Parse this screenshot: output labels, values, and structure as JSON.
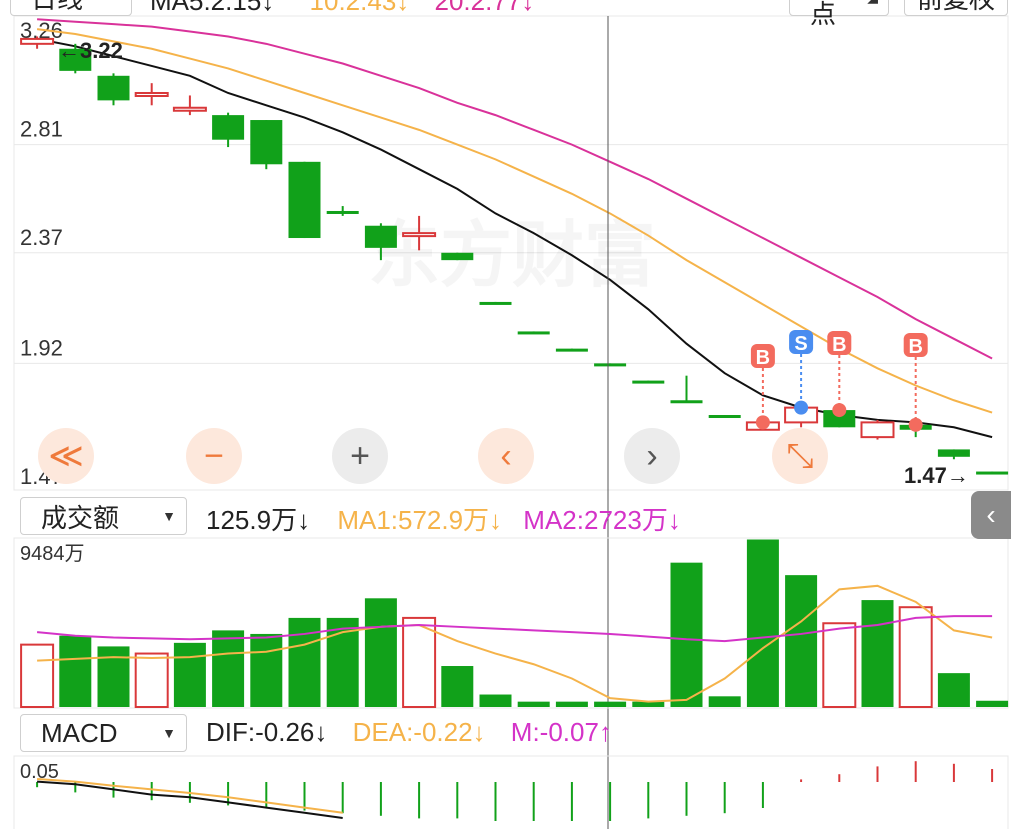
{
  "header": {
    "period_label": "日线",
    "ma_labels": [
      {
        "text": "MA5:2.15↓",
        "color": "#222222"
      },
      {
        "text": "10:2.43↓",
        "color": "#f5b34a"
      },
      {
        "text": "20:2.77↓",
        "color": "#d9329a"
      }
    ],
    "mode_label": "BK点",
    "adjust_label": "前复权"
  },
  "colors": {
    "up": "#d9383a",
    "down": "#11a11a",
    "ma5": "#111111",
    "ma10": "#f5b34a",
    "ma20": "#d9329a",
    "grid": "#e8e8e8",
    "signal_red": "#f36b5e",
    "signal_blue": "#4a8df0"
  },
  "price_panel": {
    "y_ticks": [
      "3.26",
      "2.81",
      "2.37",
      "1.92",
      "1.47"
    ],
    "high_marker": "3.22",
    "low_marker": "1.47",
    "watermark": "东方财富"
  },
  "controls": [
    {
      "name": "scroll-fast-left-button",
      "symbol": "≪",
      "style": "or"
    },
    {
      "name": "zoom-out-button",
      "symbol": "−",
      "style": "or"
    },
    {
      "name": "zoom-in-button",
      "symbol": "+",
      "style": "gr"
    },
    {
      "name": "scroll-left-button",
      "symbol": "‹",
      "style": "or"
    },
    {
      "name": "scroll-right-button",
      "symbol": "›",
      "style": "gr"
    },
    {
      "name": "expand-button",
      "symbol": "⤡",
      "style": "or"
    }
  ],
  "volume_panel": {
    "indicator": "成交额",
    "legend": [
      {
        "text": "125.9万↓",
        "color": "#222222"
      },
      {
        "text": "MA1:572.9万↓",
        "color": "#f5b34a"
      },
      {
        "text": "MA2:2723万↓",
        "color": "#d433c8"
      }
    ],
    "max_label": "9484万",
    "side_button": "‹"
  },
  "macd_panel": {
    "indicator": "MACD",
    "legend": [
      {
        "text": "DIF:-0.26↓",
        "color": "#222222"
      },
      {
        "text": "DEA:-0.22↓",
        "color": "#f5b34a"
      },
      {
        "text": "M:-0.07↑",
        "color": "#d433c8"
      }
    ],
    "top_label": "0.05"
  },
  "chart_data": [
    {
      "type": "candlestick",
      "title": "",
      "ylim": [
        1.47,
        3.26
      ],
      "candles": [
        {
          "o": 3.22,
          "c": 3.24,
          "h": 3.25,
          "l": 3.2,
          "dir": "up"
        },
        {
          "o": 3.2,
          "c": 3.11,
          "h": 3.22,
          "l": 3.1,
          "dir": "down"
        },
        {
          "o": 3.09,
          "c": 2.99,
          "h": 3.1,
          "l": 2.97,
          "dir": "down"
        },
        {
          "o": 3.01,
          "c": 3.02,
          "h": 3.06,
          "l": 2.97,
          "dir": "up"
        },
        {
          "o": 2.95,
          "c": 2.96,
          "h": 3.01,
          "l": 2.93,
          "dir": "up"
        },
        {
          "o": 2.93,
          "c": 2.83,
          "h": 2.94,
          "l": 2.8,
          "dir": "down"
        },
        {
          "o": 2.91,
          "c": 2.73,
          "h": 2.91,
          "l": 2.71,
          "dir": "down"
        },
        {
          "o": 2.74,
          "c": 2.43,
          "h": 2.74,
          "l": 2.43,
          "dir": "down"
        },
        {
          "o": 2.54,
          "c": 2.53,
          "h": 2.56,
          "l": 2.52,
          "dir": "down"
        },
        {
          "o": 2.48,
          "c": 2.39,
          "h": 2.49,
          "l": 2.34,
          "dir": "down"
        },
        {
          "o": 2.44,
          "c": 2.45,
          "h": 2.52,
          "l": 2.38,
          "dir": "up"
        },
        {
          "o": 2.37,
          "c": 2.34,
          "h": 2.37,
          "l": 2.34,
          "dir": "down"
        },
        {
          "o": 2.17,
          "c": 2.16,
          "h": 2.17,
          "l": 2.16,
          "dir": "down"
        },
        {
          "o": 2.05,
          "c": 2.04,
          "h": 2.05,
          "l": 2.04,
          "dir": "down"
        },
        {
          "o": 1.98,
          "c": 1.97,
          "h": 1.98,
          "l": 1.97,
          "dir": "down"
        },
        {
          "o": 1.92,
          "c": 1.91,
          "h": 1.92,
          "l": 1.91,
          "dir": "down"
        },
        {
          "o": 1.85,
          "c": 1.84,
          "h": 1.85,
          "l": 1.84,
          "dir": "down"
        },
        {
          "o": 1.77,
          "c": 1.76,
          "h": 1.87,
          "l": 1.76,
          "dir": "down"
        },
        {
          "o": 1.71,
          "c": 1.7,
          "h": 1.71,
          "l": 1.7,
          "dir": "down"
        },
        {
          "o": 1.65,
          "c": 1.68,
          "h": 1.7,
          "l": 1.66,
          "dir": "up"
        },
        {
          "o": 1.68,
          "c": 1.74,
          "h": 1.75,
          "l": 1.66,
          "dir": "up"
        },
        {
          "o": 1.73,
          "c": 1.66,
          "h": 1.73,
          "l": 1.66,
          "dir": "down"
        },
        {
          "o": 1.62,
          "c": 1.68,
          "h": 1.69,
          "l": 1.61,
          "dir": "up"
        },
        {
          "o": 1.67,
          "c": 1.65,
          "h": 1.7,
          "l": 1.62,
          "dir": "down"
        },
        {
          "o": 1.57,
          "c": 1.54,
          "h": 1.57,
          "l": 1.53,
          "dir": "down"
        },
        {
          "o": 1.48,
          "c": 1.47,
          "h": 1.48,
          "l": 1.47,
          "dir": "down"
        }
      ],
      "ma5": [
        3.24,
        3.21,
        3.17,
        3.13,
        3.09,
        3.02,
        2.97,
        2.92,
        2.86,
        2.79,
        2.71,
        2.63,
        2.53,
        2.45,
        2.36,
        2.26,
        2.14,
        2.0,
        1.88,
        1.79,
        1.74,
        1.71,
        1.69,
        1.68,
        1.66,
        1.62
      ],
      "ma10": [
        3.28,
        3.26,
        3.23,
        3.2,
        3.16,
        3.12,
        3.07,
        3.02,
        2.97,
        2.92,
        2.87,
        2.81,
        2.75,
        2.68,
        2.61,
        2.53,
        2.44,
        2.34,
        2.25,
        2.16,
        2.07,
        1.98,
        1.9,
        1.83,
        1.77,
        1.72
      ],
      "ma20": [
        3.32,
        3.31,
        3.3,
        3.29,
        3.27,
        3.25,
        3.22,
        3.18,
        3.14,
        3.09,
        3.04,
        2.98,
        2.93,
        2.87,
        2.81,
        2.74,
        2.67,
        2.59,
        2.51,
        2.43,
        2.35,
        2.27,
        2.19,
        2.1,
        2.02,
        1.94
      ],
      "signals": [
        {
          "index": 19,
          "label": "B"
        },
        {
          "index": 20,
          "label": "S"
        },
        {
          "index": 21,
          "label": "B"
        },
        {
          "index": 23,
          "label": "B"
        }
      ]
    },
    {
      "type": "bar",
      "title": "成交额",
      "unit": "万",
      "ylim": [
        0,
        9484
      ],
      "values": [
        3500,
        4000,
        3400,
        3000,
        3600,
        4300,
        4100,
        5000,
        5000,
        6100,
        5000,
        2300,
        700,
        300,
        300,
        300,
        300,
        8100,
        600,
        9400,
        7400,
        4700,
        6000,
        5600,
        1900,
        350
      ],
      "colors": [
        "up",
        "down",
        "down",
        "up",
        "down",
        "down",
        "down",
        "down",
        "down",
        "down",
        "up",
        "down",
        "down",
        "down",
        "down",
        "down",
        "down",
        "down",
        "down",
        "down",
        "down",
        "up",
        "down",
        "up",
        "down",
        "down"
      ],
      "ma1": [
        2600,
        2700,
        2800,
        2750,
        2800,
        3000,
        3100,
        3500,
        4200,
        4500,
        4600,
        3700,
        3000,
        2400,
        1600,
        500,
        300,
        400,
        1600,
        3300,
        4800,
        6600,
        6800,
        5900,
        4300,
        3900
      ],
      "ma2": [
        4200,
        4000,
        3900,
        3850,
        3800,
        3850,
        3900,
        4100,
        4400,
        4500,
        4600,
        4500,
        4400,
        4300,
        4200,
        4100,
        3950,
        3800,
        3700,
        3900,
        4100,
        4400,
        4600,
        5000,
        5100,
        5100
      ]
    },
    {
      "type": "macd",
      "title": "MACD",
      "ylim": [
        -0.1,
        0.05
      ],
      "hist": [
        -0.01,
        -0.02,
        -0.03,
        -0.035,
        -0.04,
        -0.045,
        -0.05,
        -0.055,
        -0.06,
        -0.065,
        -0.07,
        -0.07,
        -0.075,
        -0.075,
        -0.075,
        -0.075,
        -0.07,
        -0.065,
        -0.06,
        -0.05,
        0.005,
        0.015,
        0.03,
        0.04,
        0.035,
        0.025
      ],
      "dif": [
        0.02,
        0.015,
        0.005,
        -0.005,
        -0.01,
        -0.02,
        -0.03,
        -0.04,
        -0.05
      ],
      "dea": [
        0.025,
        0.02,
        0.012,
        0.005,
        -0.002,
        -0.01,
        -0.02,
        -0.03,
        -0.04
      ]
    }
  ]
}
